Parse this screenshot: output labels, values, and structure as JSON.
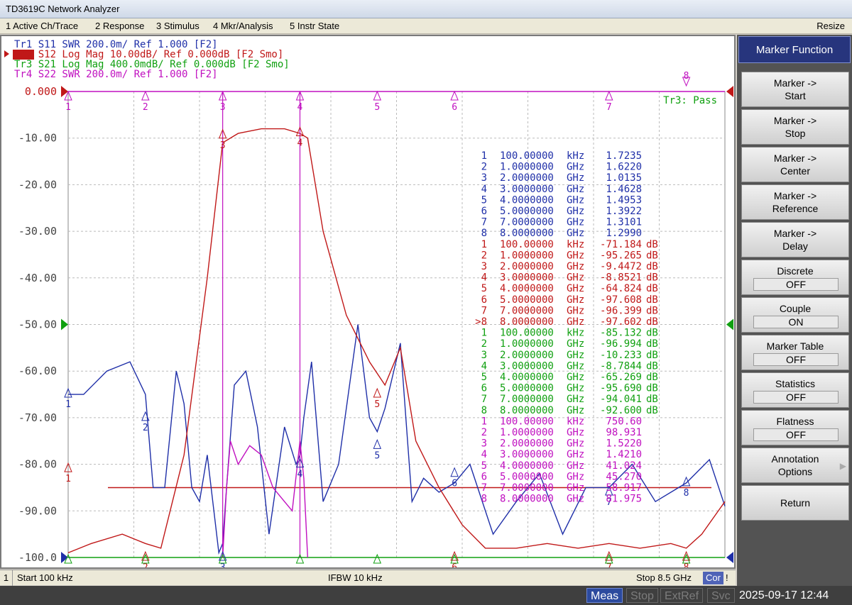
{
  "window": {
    "title": "TD3619C Network Analyzer"
  },
  "menu": {
    "items": [
      "1 Active Ch/Trace",
      "2 Response",
      "3 Stimulus",
      "4 Mkr/Analysis",
      "5 Instr State"
    ],
    "resize": "Resize"
  },
  "traces": [
    {
      "id": "Tr1",
      "param": "S11",
      "format": "SWR",
      "scale": "200.0m/",
      "ref": "Ref 1.000",
      "flags": "[F2]",
      "color": "#1f2fa8",
      "active": false
    },
    {
      "id": "Tr2",
      "param": "S12",
      "format": "Log Mag",
      "scale": "10.00dB/",
      "ref": "Ref 0.000dB",
      "flags": "[F2 Smo]",
      "color": "#c01818",
      "active": true
    },
    {
      "id": "Tr3",
      "param": "S21",
      "format": "Log Mag",
      "scale": "400.0mdB/",
      "ref": "Ref 0.000dB",
      "flags": "[F2 Smo]",
      "color": "#10a010",
      "active": false
    },
    {
      "id": "Tr4",
      "param": "S22",
      "format": "SWR",
      "scale": "200.0m/",
      "ref": "Ref 1.000",
      "flags": "[F2]",
      "color": "#c010c0",
      "active": false
    }
  ],
  "y_axis_labels": [
    "0.000",
    "-10.00",
    "-20.00",
    "-30.00",
    "-40.00",
    "-50.00",
    "-60.00",
    "-70.00",
    "-80.00",
    "-90.00",
    "-100.0"
  ],
  "limit_status": "Tr3: Pass",
  "marker_table": [
    {
      "tr": 1,
      "rows": [
        {
          "n": "1",
          "freq": "100.00000",
          "unit": "kHz",
          "val": "1.7235",
          "vunit": ""
        },
        {
          "n": "2",
          "freq": "1.0000000",
          "unit": "GHz",
          "val": "1.6220",
          "vunit": ""
        },
        {
          "n": "3",
          "freq": "2.0000000",
          "unit": "GHz",
          "val": "1.0135",
          "vunit": ""
        },
        {
          "n": "4",
          "freq": "3.0000000",
          "unit": "GHz",
          "val": "1.4628",
          "vunit": ""
        },
        {
          "n": "5",
          "freq": "4.0000000",
          "unit": "GHz",
          "val": "1.4953",
          "vunit": ""
        },
        {
          "n": "6",
          "freq": "5.0000000",
          "unit": "GHz",
          "val": "1.3922",
          "vunit": ""
        },
        {
          "n": "7",
          "freq": "7.0000000",
          "unit": "GHz",
          "val": "1.3101",
          "vunit": ""
        },
        {
          "n": "8",
          "freq": "8.0000000",
          "unit": "GHz",
          "val": "1.2990",
          "vunit": ""
        }
      ]
    },
    {
      "tr": 2,
      "rows": [
        {
          "n": "1",
          "freq": "100.00000",
          "unit": "kHz",
          "val": "-71.184",
          "vunit": "dB"
        },
        {
          "n": "2",
          "freq": "1.0000000",
          "unit": "GHz",
          "val": "-95.265",
          "vunit": "dB"
        },
        {
          "n": "3",
          "freq": "2.0000000",
          "unit": "GHz",
          "val": "-9.4472",
          "vunit": "dB"
        },
        {
          "n": "4",
          "freq": "3.0000000",
          "unit": "GHz",
          "val": "-8.8521",
          "vunit": "dB"
        },
        {
          "n": "5",
          "freq": "4.0000000",
          "unit": "GHz",
          "val": "-64.824",
          "vunit": "dB"
        },
        {
          "n": "6",
          "freq": "5.0000000",
          "unit": "GHz",
          "val": "-97.608",
          "vunit": "dB"
        },
        {
          "n": "7",
          "freq": "7.0000000",
          "unit": "GHz",
          "val": "-96.399",
          "vunit": "dB"
        },
        {
          "n": ">8",
          "freq": "8.0000000",
          "unit": "GHz",
          "val": "-97.602",
          "vunit": "dB"
        }
      ]
    },
    {
      "tr": 3,
      "rows": [
        {
          "n": "1",
          "freq": "100.00000",
          "unit": "kHz",
          "val": "-85.132",
          "vunit": "dB"
        },
        {
          "n": "2",
          "freq": "1.0000000",
          "unit": "GHz",
          "val": "-96.994",
          "vunit": "dB"
        },
        {
          "n": "3",
          "freq": "2.0000000",
          "unit": "GHz",
          "val": "-10.233",
          "vunit": "dB"
        },
        {
          "n": "4",
          "freq": "3.0000000",
          "unit": "GHz",
          "val": "-8.7844",
          "vunit": "dB"
        },
        {
          "n": "5",
          "freq": "4.0000000",
          "unit": "GHz",
          "val": "-65.269",
          "vunit": "dB"
        },
        {
          "n": "6",
          "freq": "5.0000000",
          "unit": "GHz",
          "val": "-95.690",
          "vunit": "dB"
        },
        {
          "n": "7",
          "freq": "7.0000000",
          "unit": "GHz",
          "val": "-94.041",
          "vunit": "dB"
        },
        {
          "n": "8",
          "freq": "8.0000000",
          "unit": "GHz",
          "val": "-92.600",
          "vunit": "dB"
        }
      ]
    },
    {
      "tr": 4,
      "rows": [
        {
          "n": "1",
          "freq": "100.00000",
          "unit": "kHz",
          "val": "750.60",
          "vunit": ""
        },
        {
          "n": "2",
          "freq": "1.0000000",
          "unit": "GHz",
          "val": "98.931",
          "vunit": ""
        },
        {
          "n": "3",
          "freq": "2.0000000",
          "unit": "GHz",
          "val": "1.5220",
          "vunit": ""
        },
        {
          "n": "4",
          "freq": "3.0000000",
          "unit": "GHz",
          "val": "1.4210",
          "vunit": ""
        },
        {
          "n": "5",
          "freq": "4.0000000",
          "unit": "GHz",
          "val": "41.024",
          "vunit": ""
        },
        {
          "n": "6",
          "freq": "5.0000000",
          "unit": "GHz",
          "val": "45.270",
          "vunit": ""
        },
        {
          "n": "7",
          "freq": "7.0000000",
          "unit": "GHz",
          "val": "58.917",
          "vunit": ""
        },
        {
          "n": "8",
          "freq": "8.0000000",
          "unit": "GHz",
          "val": "81.975",
          "vunit": ""
        }
      ]
    }
  ],
  "chart_data": {
    "type": "line",
    "x_unit": "GHz",
    "xlim": [
      0.0001,
      8.5
    ],
    "ylim": [
      -100,
      0
    ],
    "grid": true,
    "limit_line_y": -85,
    "series": [
      {
        "name": "Tr1",
        "color": "#1f2fa8",
        "x": [
          0.0001,
          0.2,
          0.5,
          0.8,
          1.0,
          1.1,
          1.25,
          1.4,
          1.5,
          1.6,
          1.7,
          1.8,
          1.9,
          1.95,
          2.0,
          2.05,
          2.15,
          2.3,
          2.45,
          2.6,
          2.8,
          2.95,
          3.0,
          3.05,
          3.15,
          3.3,
          3.5,
          3.75,
          3.9,
          4.0,
          4.1,
          4.3,
          4.45,
          4.6,
          4.8,
          5.0,
          5.2,
          5.5,
          5.8,
          6.1,
          6.4,
          6.7,
          7.0,
          7.3,
          7.6,
          8.0,
          8.3,
          8.5
        ],
        "y": [
          -65,
          -65,
          -60,
          -58,
          -65,
          -85,
          -85,
          -60,
          -67,
          -85,
          -88,
          -78,
          -92,
          -99,
          -97,
          -85,
          -63,
          -60,
          -72,
          -95,
          -72,
          -80,
          -78,
          -70,
          -58,
          -88,
          -80,
          -50,
          -70,
          -73,
          -68,
          -54,
          -88,
          -83,
          -86,
          -84,
          -80,
          -95,
          -88,
          -82,
          -95,
          -85,
          -85,
          -80,
          -88,
          -84,
          -79,
          -89
        ]
      },
      {
        "name": "Tr2",
        "color": "#c01818",
        "x": [
          0.0001,
          0.3,
          0.7,
          1.0,
          1.2,
          1.5,
          1.8,
          2.0,
          2.2,
          2.5,
          2.8,
          3.0,
          3.1,
          3.3,
          3.6,
          3.9,
          4.1,
          4.3,
          4.5,
          4.8,
          5.1,
          5.4,
          5.8,
          6.2,
          6.6,
          7.0,
          7.4,
          7.8,
          8.0,
          8.2,
          8.5
        ],
        "y": [
          -99,
          -97,
          -95,
          -97,
          -98,
          -78,
          -40,
          -11,
          -9,
          -8,
          -8,
          -9,
          -10,
          -30,
          -48,
          -58,
          -63,
          -55,
          -75,
          -85,
          -93,
          -98,
          -98,
          -97,
          -98,
          -97,
          -98,
          -97,
          -98,
          -95,
          -88
        ]
      },
      {
        "name": "Tr3",
        "color": "#10a010",
        "x": [
          0.0001,
          8.5
        ],
        "y": [
          -100,
          -100
        ]
      },
      {
        "name": "Tr4",
        "color": "#c010c0",
        "x": [
          2.0,
          2.05,
          2.1,
          2.2,
          2.35,
          2.5,
          2.65,
          2.8,
          2.9,
          3.0,
          3.05,
          3.1
        ],
        "y": [
          -100,
          -85,
          -75,
          -80,
          -76,
          -78,
          -85,
          -88,
          -90,
          -75,
          -83,
          -100
        ]
      }
    ]
  },
  "status": {
    "channel": "1",
    "start": "Start 100 kHz",
    "ifbw": "IFBW 10 kHz",
    "stop": "Stop 8.5 GHz",
    "cor": "Cor",
    "bang": "!"
  },
  "bottom": {
    "meas": "Meas",
    "stop": "Stop",
    "extref": "ExtRef",
    "svc": "Svc",
    "datetime": "2025-09-17 12:44"
  },
  "softkeys": {
    "title": "Marker Function",
    "buttons": [
      {
        "line1": "Marker ->",
        "line2": "Start"
      },
      {
        "line1": "Marker ->",
        "line2": "Stop"
      },
      {
        "line1": "Marker ->",
        "line2": "Center"
      },
      {
        "line1": "Marker ->",
        "line2": "Reference"
      },
      {
        "line1": "Marker ->",
        "line2": "Delay"
      },
      {
        "line1": "Discrete",
        "state": "OFF"
      },
      {
        "line1": "Couple",
        "state": "ON"
      },
      {
        "line1": "Marker Table",
        "state": "OFF"
      },
      {
        "line1": "Statistics",
        "state": "OFF"
      },
      {
        "line1": "Flatness",
        "state": "OFF"
      },
      {
        "line1": "Annotation",
        "line2": "Options",
        "arrow": "▶"
      },
      {
        "line1": "Return"
      }
    ]
  }
}
